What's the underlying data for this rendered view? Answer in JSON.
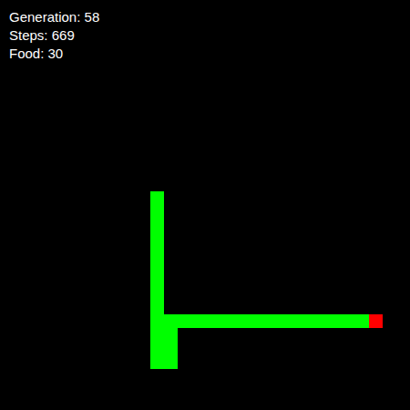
{
  "hud": [
    "Generation: 58",
    "Steps: 669",
    "Food: 30"
  ],
  "board": {
    "cols": 30,
    "rows": 30
  },
  "snake": [
    [
      26,
      23
    ],
    [
      25,
      23
    ],
    [
      24,
      23
    ],
    [
      23,
      23
    ],
    [
      22,
      23
    ],
    [
      21,
      23
    ],
    [
      20,
      23
    ],
    [
      19,
      23
    ],
    [
      18,
      23
    ],
    [
      17,
      23
    ],
    [
      16,
      23
    ],
    [
      15,
      23
    ],
    [
      14,
      23
    ],
    [
      13,
      23
    ],
    [
      12,
      23
    ],
    [
      12,
      24
    ],
    [
      12,
      25
    ],
    [
      12,
      26
    ],
    [
      11,
      26
    ],
    [
      11,
      25
    ],
    [
      11,
      24
    ],
    [
      11,
      23
    ],
    [
      11,
      22
    ],
    [
      11,
      21
    ],
    [
      11,
      20
    ],
    [
      11,
      19
    ],
    [
      11,
      18
    ],
    [
      11,
      17
    ],
    [
      11,
      16
    ],
    [
      11,
      15
    ],
    [
      11,
      14
    ]
  ],
  "food": [
    27,
    23
  ]
}
